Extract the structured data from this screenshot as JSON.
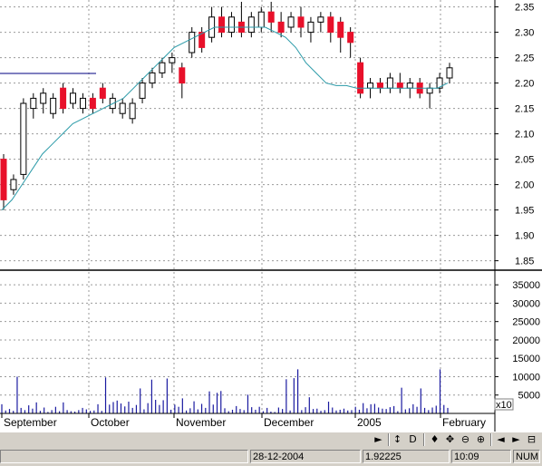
{
  "chart_data": [
    {
      "type": "candlestick",
      "y_ticks": [
        "2.35",
        "2.30",
        "2.25",
        "2.20",
        "2.15",
        "2.10",
        "2.05",
        "2.00",
        "1.95",
        "1.90",
        "1.85"
      ],
      "ylim": [
        1.835,
        2.36
      ],
      "x_labels": [
        "September",
        "October",
        "November",
        "December",
        "2005",
        "February"
      ],
      "moving_average": [
        1.95,
        1.97,
        2.0,
        2.03,
        2.06,
        2.08,
        2.1,
        2.12,
        2.13,
        2.14,
        2.15,
        2.16,
        2.17,
        2.19,
        2.21,
        2.23,
        2.25,
        2.27,
        2.28,
        2.29,
        2.3,
        2.31,
        2.31,
        2.31,
        2.31,
        2.31,
        2.31,
        2.3,
        2.29,
        2.27,
        2.24,
        2.22,
        2.2,
        2.195,
        2.195,
        2.19,
        2.19,
        2.19,
        2.19,
        2.19,
        2.19,
        2.19,
        2.19,
        2.19,
        2.2
      ],
      "candles": [
        [
          1.97,
          2.05,
          2.06,
          1.95,
          "down"
        ],
        [
          1.99,
          2.01,
          2.02,
          1.98,
          "up"
        ],
        [
          2.02,
          2.16,
          2.17,
          2.01,
          "up"
        ],
        [
          2.15,
          2.17,
          2.18,
          2.13,
          "up"
        ],
        [
          2.16,
          2.18,
          2.19,
          2.14,
          "up"
        ],
        [
          2.14,
          2.17,
          2.18,
          2.13,
          "up"
        ],
        [
          2.19,
          2.15,
          2.2,
          2.14,
          "down"
        ],
        [
          2.16,
          2.18,
          2.19,
          2.15,
          "up"
        ],
        [
          2.15,
          2.17,
          2.18,
          2.14,
          "up"
        ],
        [
          2.17,
          2.15,
          2.18,
          2.14,
          "down"
        ],
        [
          2.19,
          2.17,
          2.2,
          2.16,
          "down"
        ],
        [
          2.15,
          2.17,
          2.18,
          2.14,
          "up"
        ],
        [
          2.14,
          2.16,
          2.17,
          2.13,
          "up"
        ],
        [
          2.13,
          2.16,
          2.17,
          2.12,
          "up"
        ],
        [
          2.17,
          2.2,
          2.21,
          2.16,
          "up"
        ],
        [
          2.2,
          2.22,
          2.23,
          2.19,
          "up"
        ],
        [
          2.22,
          2.24,
          2.25,
          2.21,
          "up"
        ],
        [
          2.24,
          2.25,
          2.26,
          2.22,
          "up"
        ],
        [
          2.23,
          2.2,
          2.24,
          2.17,
          "down"
        ],
        [
          2.26,
          2.3,
          2.31,
          2.25,
          "up"
        ],
        [
          2.3,
          2.27,
          2.31,
          2.26,
          "down"
        ],
        [
          2.29,
          2.33,
          2.35,
          2.28,
          "up"
        ],
        [
          2.33,
          2.3,
          2.35,
          2.29,
          "down"
        ],
        [
          2.3,
          2.33,
          2.34,
          2.29,
          "up"
        ],
        [
          2.32,
          2.3,
          2.36,
          2.29,
          "down"
        ],
        [
          2.3,
          2.33,
          2.34,
          2.29,
          "up"
        ],
        [
          2.31,
          2.34,
          2.35,
          2.3,
          "up"
        ],
        [
          2.34,
          2.32,
          2.36,
          2.3,
          "down"
        ],
        [
          2.32,
          2.3,
          2.34,
          2.29,
          "down"
        ],
        [
          2.31,
          2.33,
          2.34,
          2.3,
          "up"
        ],
        [
          2.33,
          2.31,
          2.35,
          2.29,
          "down"
        ],
        [
          2.3,
          2.32,
          2.33,
          2.28,
          "up"
        ],
        [
          2.32,
          2.33,
          2.34,
          2.3,
          "up"
        ],
        [
          2.33,
          2.3,
          2.34,
          2.28,
          "down"
        ],
        [
          2.32,
          2.29,
          2.33,
          2.26,
          "down"
        ],
        [
          2.3,
          2.28,
          2.31,
          2.25,
          "down"
        ],
        [
          2.24,
          2.18,
          2.25,
          2.17,
          "down"
        ],
        [
          2.19,
          2.2,
          2.21,
          2.17,
          "up"
        ],
        [
          2.2,
          2.19,
          2.21,
          2.18,
          "down"
        ],
        [
          2.19,
          2.21,
          2.22,
          2.18,
          "up"
        ],
        [
          2.2,
          2.19,
          2.22,
          2.18,
          "down"
        ],
        [
          2.19,
          2.2,
          2.21,
          2.17,
          "up"
        ],
        [
          2.2,
          2.18,
          2.21,
          2.17,
          "down"
        ],
        [
          2.18,
          2.19,
          2.2,
          2.15,
          "up"
        ],
        [
          2.19,
          2.21,
          2.22,
          2.18,
          "up"
        ],
        [
          2.21,
          2.23,
          2.24,
          2.2,
          "up"
        ]
      ]
    },
    {
      "type": "bar",
      "y_ticks": [
        "35000",
        "30000",
        "25000",
        "20000",
        "15000",
        "10000",
        "5000"
      ],
      "ylim": [
        0,
        38000
      ],
      "multiplier_label": "x10",
      "values": [
        2500,
        800,
        1200,
        700,
        10000,
        1500,
        900,
        2200,
        1300,
        3000,
        700,
        1600,
        400,
        900,
        1800,
        600,
        3000,
        900,
        600,
        500,
        900,
        1500,
        1100,
        700,
        800,
        2500,
        700,
        9800,
        2400,
        3100,
        3500,
        2700,
        1900,
        3200,
        1500,
        2300,
        6800,
        1100,
        2800,
        9200,
        3700,
        2300,
        3600,
        9500,
        1000,
        2400,
        1800,
        4100,
        800,
        1400,
        3300,
        1100,
        2600,
        1500,
        6000,
        2400,
        5600,
        6100,
        1400,
        600,
        1000,
        2000,
        1200,
        900,
        5100,
        1700,
        1000,
        1800,
        600,
        1500,
        500,
        400,
        1600,
        1200,
        9300,
        800,
        9600,
        12000,
        900,
        1700,
        4400,
        1200,
        1300,
        700,
        900,
        3200,
        1600,
        800,
        1000,
        1300,
        800,
        900,
        1800,
        1000,
        2800,
        1400,
        2500,
        2600,
        1600,
        1300,
        1200,
        1700,
        2000,
        600,
        7000,
        1100,
        1400,
        2500,
        1800,
        6800,
        1500,
        900,
        1600,
        2100,
        12000,
        2300,
        1500
      ]
    }
  ],
  "status": {
    "date": "28-12-2004",
    "price": "1.92225",
    "time": "10:09",
    "num": "NUM"
  },
  "toolbar": {
    "arrow_right": "►",
    "refresh": "↕",
    "d_label": "D",
    "updown": "♦",
    "move": "✥",
    "zoom_out": "⊖",
    "zoom_in": "⊕",
    "left": "◄",
    "right": "►",
    "save": "⊟"
  }
}
